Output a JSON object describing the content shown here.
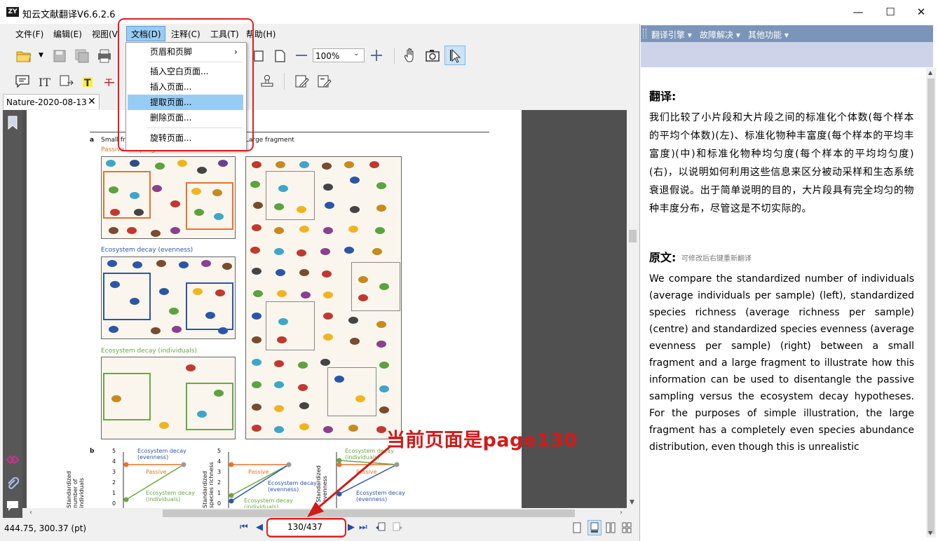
{
  "app": {
    "logo": "ZY",
    "title": "知云文献翻译V6.6.2.6",
    "window_controls": {
      "minimize": "—",
      "maximize": "☐",
      "close": "✕"
    }
  },
  "menubar": {
    "items": [
      "文件(F)",
      "编辑(E)",
      "视图(V",
      "文档(D)",
      "注释(C)",
      "工具(T)",
      "帮助(H)"
    ]
  },
  "toolbar": {
    "zoom": "100%"
  },
  "tab": {
    "label": "Nature-2020-08-13",
    "close": "✕"
  },
  "dropdown": {
    "items": [
      {
        "label": "页眉和页脚",
        "has_submenu": true
      },
      {
        "label": "插入空白页面..."
      },
      {
        "label": "插入页面..."
      },
      {
        "label": "提取页面..."
      },
      {
        "label": "删除页面..."
      },
      {
        "label": "旋转页面..."
      }
    ],
    "submenu_arrow": "›",
    "highlighted_index": 3
  },
  "document_page": {
    "panel_a": "a",
    "small_label": "Small fr",
    "large_label": "Large fragment",
    "passive_label": "Passive sampling",
    "evenness_label": "Ecosystem decay (evenness)",
    "individuals_label": "Ecosystem decay (individuals)",
    "panel_b": "b",
    "plot1": {
      "y_label": "Standardized number of individuals",
      "ticks": [
        "5",
        "4",
        "3",
        "2",
        "1",
        "0"
      ],
      "series": [
        "Ecosystem decay (evenness)",
        "Passive",
        "Ecosystem decay (individuals)"
      ]
    },
    "plot2": {
      "y_label": "Standardized species richness",
      "ticks": [
        "5",
        "4",
        "3",
        "2",
        "1",
        "0"
      ],
      "series": [
        "Passive",
        "Ecosystem decay (evenness)",
        "Ecosystem decay (individuals)"
      ]
    },
    "plot3": {
      "y_label": "Standardized evenness",
      "series": [
        "Ecosystem decay (individuals)",
        "Passive",
        "Ecosystem decay (evenness)"
      ]
    }
  },
  "statusbar": {
    "coords": "444.75, 300.37 (pt)",
    "page_indicator": "130/437"
  },
  "annotation": {
    "text": "当前页面是page130",
    "color": "#d21a1a"
  },
  "right_panel": {
    "menu": [
      {
        "label": "翻译引擎"
      },
      {
        "label": "故障解决"
      },
      {
        "label": "其他功能"
      }
    ],
    "menu_arrow": "▾",
    "translation_heading": "翻译:",
    "translation_text": "我们比较了小片段和大片段之间的标准化个体数(每个样本的平均个体数)(左)、标准化物种丰富度(每个样本的平均丰富度)(中)和标准化物种均匀度(每个样本的平均均匀度)(右)，以说明如何利用这些信息来区分被动采样和生态系统衰退假说。出于简单说明的目的，大片段具有完全均匀的物种丰度分布，尽管这是不切实际的。",
    "source_heading": "原文:",
    "source_hint": "可修改后右键重新翻译",
    "source_text": "We compare the standardized number of individuals (average individuals per sample) (left), standardized species richness (average richness per sample) (centre) and standardized species evenness (average evenness per sample) (right) between a small fragment and a large fragment to illustrate how this information can be used to disentangle the passive sampling versus the ecosystem decay hypotheses. For the purposes of simple illustration, the large fragment has a completely even species abundance distribution, even though this is unrealistic"
  },
  "colors": {
    "accent_red": "#e31d1d",
    "menu_highlight": "#99ccf3",
    "right_toolbar": "#7a95b8",
    "passive_orange": "#e8732a",
    "evenness_blue": "#2b56a8",
    "individuals_green": "#6aa843"
  }
}
